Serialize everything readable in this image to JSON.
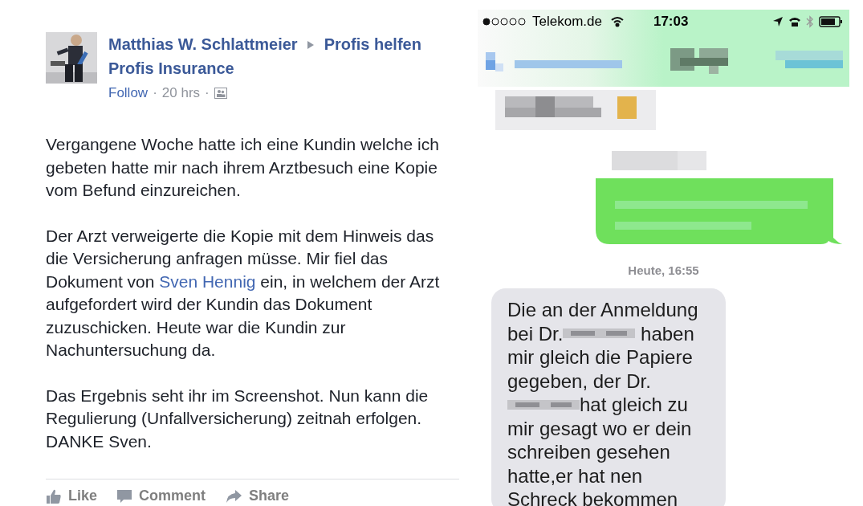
{
  "post": {
    "author": "Matthias W. Schlattmeier",
    "group_lines": [
      "Profis helfen",
      "Profis Insurance"
    ],
    "meta": [
      {
        "kind": "link",
        "text": "Follow"
      },
      {
        "kind": "sep",
        "text": "·"
      },
      {
        "kind": "time",
        "text": "20 hrs"
      },
      {
        "kind": "sep",
        "text": "·"
      },
      {
        "kind": "audience"
      }
    ],
    "paragraphs": [
      [
        {
          "text": "Vergangene Woche hatte ich eine Kundin welche ich gebeten hatte mir nach ihrem Arztbesuch eine Kopie vom Befund einzureichen."
        }
      ],
      [
        {
          "text": "Der Arzt verweigerte die Kopie mit dem Hinweis das die Versicherung anfragen müsse. Mir fiel das Dokument von "
        },
        {
          "link": "Sven Hennig"
        },
        {
          "text": " ein, in welchem der Arzt aufgefordert wird der Kundin das Dokument zuzuschicken. Heute war die Kundin zur Nachuntersuchung da."
        }
      ],
      [
        {
          "text": "Das Ergebnis seht ihr im Screenshot. Nun kann die Regulierung (Unfallversicherung) zeitnah erfolgen. DANKE Sven."
        }
      ]
    ],
    "actions": [
      {
        "kind": "like",
        "label": "Like"
      },
      {
        "kind": "comment",
        "label": "Comment"
      },
      {
        "kind": "share",
        "label": "Share"
      }
    ]
  },
  "phone": {
    "carrier": "Telekom.de",
    "time": "17:03",
    "messages": [
      {
        "kind": "blurred-incoming"
      },
      {
        "kind": "blurred-outgoing"
      },
      {
        "kind": "timestamp",
        "text": "Heute, 16:55"
      },
      {
        "kind": "incoming",
        "lines": [
          [
            {
              "text": "Die an der Anmeldung"
            }
          ],
          [
            {
              "kind": "text",
              "text": "bei Dr."
            },
            {
              "kind": "redacted"
            },
            {
              "kind": "text",
              "text": " haben"
            }
          ],
          [
            {
              "text": "mir gleich die Papiere"
            }
          ],
          [
            {
              "text": "gegeben, der Dr."
            }
          ],
          [
            {
              "kind": "redacted"
            },
            {
              "kind": "text",
              "text": "hat gleich zu"
            }
          ],
          [
            {
              "text": "mir gesagt wo er dein"
            }
          ],
          [
            {
              "text": "schreiben gesehen"
            }
          ],
          [
            {
              "text": "hatte,er hat nen"
            }
          ],
          [
            {
              "text": "Schreck bekommen"
            }
          ]
        ]
      }
    ]
  }
}
